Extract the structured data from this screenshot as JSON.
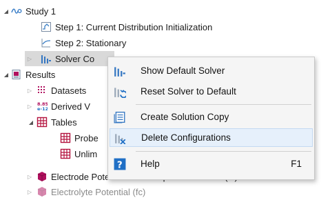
{
  "tree": {
    "study": "Study 1",
    "step1": "Step 1: Current Distribution Initialization",
    "step2": "Step 2: Stationary",
    "solver": "Solver Co",
    "results": "Results",
    "datasets": "Datasets",
    "derived": "Derived V",
    "derived_icon_text": "8.85\ne-12",
    "tables": "Tables",
    "probe": "Probe",
    "unlim": "Unlim",
    "electrode": "Electrode Potential with Respect to Ground (fc)",
    "electrolyte": "Electrolyte Potential (fc)"
  },
  "menu": {
    "items": [
      {
        "label": "Show Default Solver",
        "icon": "solver-icon"
      },
      {
        "label": "Reset Solver to Default",
        "icon": "reset-solver-icon"
      },
      {
        "label": "Create Solution Copy",
        "icon": "solution-copy-icon"
      },
      {
        "label": "Delete Configurations",
        "icon": "delete-configurations-icon"
      },
      {
        "label": "Help",
        "icon": "help-icon",
        "shortcut": "F1"
      }
    ]
  },
  "colors": {
    "selected_bg": "#d9d9d9",
    "hover_bg": "#e6f0fb",
    "accent_blue": "#1f6fc5",
    "table_red": "#b3123e",
    "dataset_magenta": "#b0105e"
  }
}
